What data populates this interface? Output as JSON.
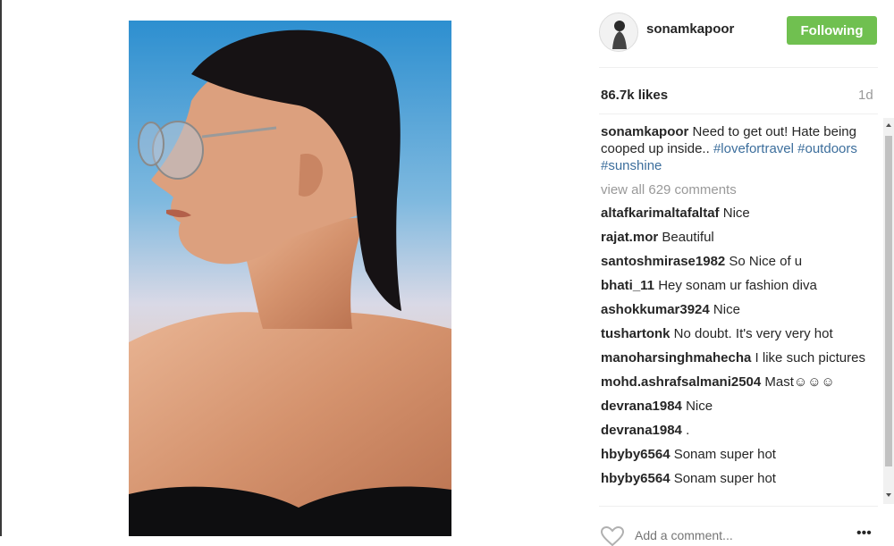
{
  "post": {
    "username": "sonamkapoor",
    "follow_label": "Following",
    "likes": "86.7k likes",
    "time": "1d",
    "caption": {
      "username": "sonamkapoor",
      "text": " Need to get out! Hate being cooped up inside.. ",
      "tag1": "#lovefortravel",
      "tag2": "#outdoors",
      "tag3": "#sunshine"
    },
    "view_all": "view all 629 comments",
    "comments": [
      {
        "user": "altafkarimaltafaltaf",
        "text": " Nice"
      },
      {
        "user": "rajat.mor",
        "text": " Beautiful"
      },
      {
        "user": "santoshmirase1982",
        "text": " So Nice of u"
      },
      {
        "user": "bhati_11",
        "text": " Hey sonam ur fashion diva"
      },
      {
        "user": "ashokkumar3924",
        "text": " Nice"
      },
      {
        "user": "tushartonk",
        "text": " No doubt. It's very very hot"
      },
      {
        "user": "manoharsinghmahecha",
        "text": " I like such pictures"
      },
      {
        "user": "mohd.ashrafsalmani2504",
        "text": " Mast☺☺☺"
      },
      {
        "user": "devrana1984",
        "text": " Nice"
      },
      {
        "user": "devrana1984",
        "text": " ."
      },
      {
        "user": "hbyby6564",
        "text": " Sonam super hot"
      },
      {
        "user": "hbyby6564",
        "text": " Sonam super hot"
      }
    ],
    "add_comment_placeholder": "Add a comment...",
    "more_label": "•••"
  },
  "colors": {
    "follow_button": "#70c050",
    "hashtag": "#3c6e9c",
    "muted": "#999999"
  },
  "icons": {
    "heart": "heart-icon",
    "more": "more-options-icon"
  }
}
